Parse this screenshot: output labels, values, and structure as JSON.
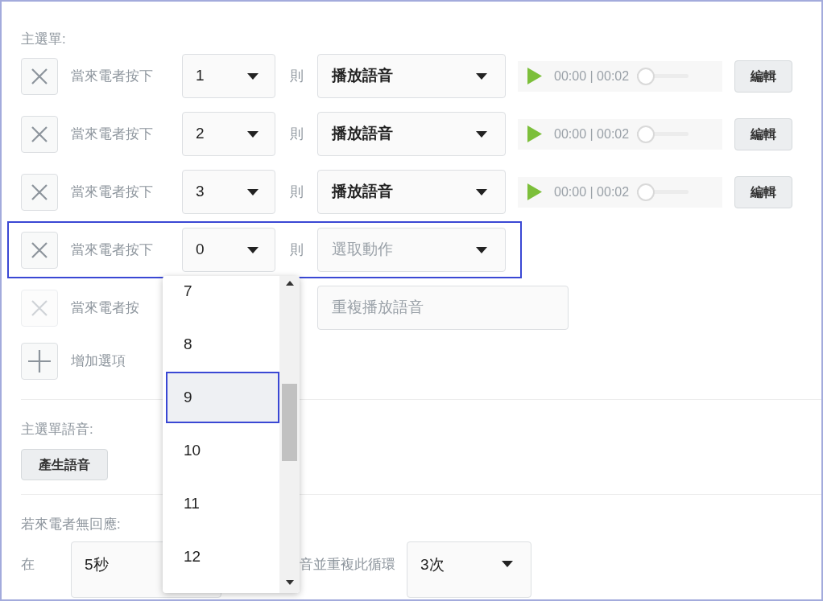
{
  "menu_title": "主選單:",
  "options": [
    {
      "kind": "audio",
      "label": "當來電者按下",
      "key": "1",
      "then": "則",
      "action": "播放語音",
      "highlighted": false,
      "disabled": false,
      "player": {
        "time": "00:00 | 00:02",
        "level": 0
      },
      "edit": "編輯"
    },
    {
      "kind": "audio",
      "label": "當來電者按下",
      "key": "2",
      "then": "則",
      "action": "播放語音",
      "highlighted": false,
      "disabled": false,
      "player": {
        "time": "00:00 | 00:02",
        "level": 0
      },
      "edit": "編輯"
    },
    {
      "kind": "audio",
      "label": "當來電者按下",
      "key": "3",
      "then": "則",
      "action": "播放語音",
      "highlighted": false,
      "disabled": false,
      "player": {
        "time": "00:00 | 00:02",
        "level": 0
      },
      "edit": "編輯"
    },
    {
      "kind": "pending",
      "label": "當來電者按下",
      "key": "0",
      "then": "則",
      "placeholder": "選取動作",
      "highlighted": true,
      "disabled": false
    },
    {
      "kind": "repeat",
      "label": "當來電者按",
      "action": "重複播放語音",
      "highlighted": false,
      "disabled": true
    }
  ],
  "add_option": "增加選項",
  "voice_title": "主選單語音:",
  "generate_button": "產生語音",
  "no_response_title": "若來電者無回應:",
  "no_response": {
    "prefix": "在",
    "wait": "5秒",
    "suffix": "音並重複此循環",
    "repeat": "3次"
  },
  "key_dropdown": {
    "options": [
      {
        "label": "7",
        "selected": false
      },
      {
        "label": "8",
        "selected": false
      },
      {
        "label": "9",
        "selected": true
      },
      {
        "label": "10",
        "selected": false
      },
      {
        "label": "11",
        "selected": false
      },
      {
        "label": "12",
        "selected": false
      }
    ]
  }
}
